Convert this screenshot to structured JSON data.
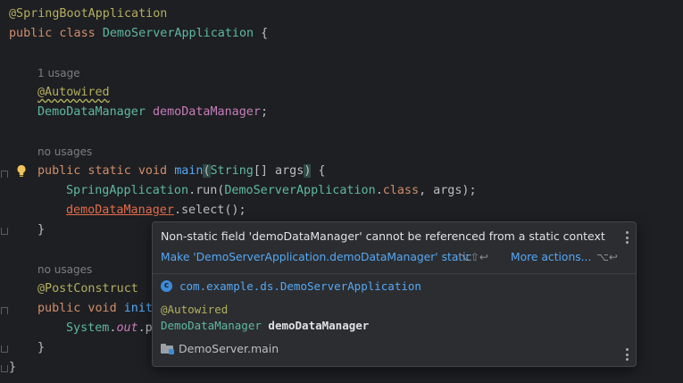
{
  "code": {
    "l1": "@SpringBootApplication",
    "l2_kw": "public class ",
    "l2_cls": "DemoServerApplication",
    "l2_rest": " {",
    "usage1": "1 usage",
    "ann_autowired": "@Autowired",
    "field_type": "DemoDataManager",
    "field_name": "demoDataManager",
    "semicolon": ";",
    "usage2": "no usages",
    "main_kw": "public static void ",
    "main_name": "main",
    "main_open": "(",
    "main_type": "String",
    "main_args": "[] args",
    "main_close": ")",
    "main_brace": " {",
    "run_cls": "SpringApplication",
    "run_call": ".run(",
    "run_arg_cls": "DemoServerApplication",
    "run_dot": ".",
    "run_kw": "class",
    "run_end": ", args);",
    "err_field": "demoDataManager",
    "select_call": ".select();",
    "close_brace": "}",
    "usage3": "no usages",
    "ann_postconstruct": "@PostConstruct",
    "init_kw": "public void ",
    "init_name": "init",
    "sys_cls": "System",
    "sys_dot": ".",
    "sys_out": "out",
    "sys_rest": ".p",
    "final_brace": "}"
  },
  "popup": {
    "message": "Non-static field 'demoDataManager' cannot be referenced from a static context",
    "action_make_static": "Make 'DemoServerApplication.demoDataManager' static",
    "shortcut_make_static": "⌥⇧↩",
    "action_more": "More actions...",
    "shortcut_more": "⌥↩",
    "class_icon_letter": "c",
    "class_fqn": "com.example.ds.DemoServerApplication",
    "decl_annotation": "@Autowired",
    "decl_type": "DemoDataManager",
    "decl_name": "demoDataManager",
    "module": "DemoServer.main"
  },
  "colors": {
    "background": "#1e1f22",
    "popup_bg": "#2b2d30",
    "link": "#56a8f5",
    "error": "#e06c4c"
  },
  "icons": [
    "intention-bulb-icon",
    "class-icon",
    "module-folder-icon",
    "more-options-icon"
  ]
}
